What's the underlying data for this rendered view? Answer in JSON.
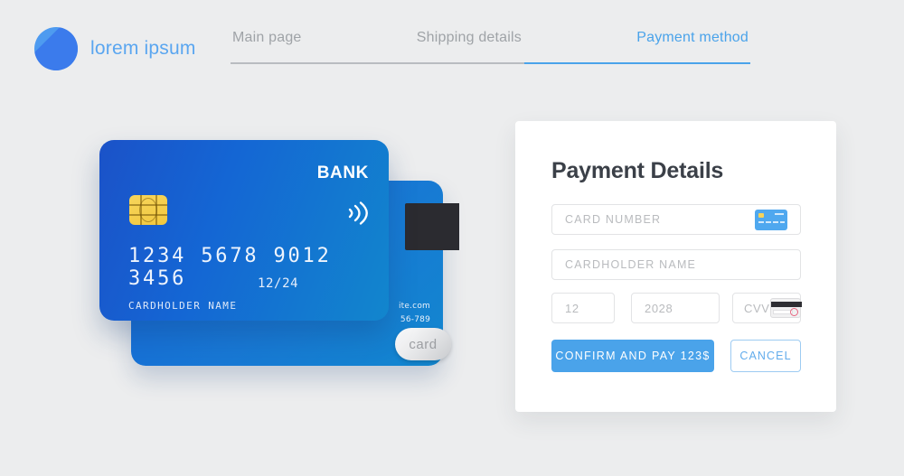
{
  "brand": {
    "name": "lorem ipsum",
    "logo_icon": "circle-triangle-logo-icon",
    "accent_color": "#5aa6f0"
  },
  "nav": {
    "tabs": [
      {
        "label": "Main page",
        "active": false
      },
      {
        "label": "Shipping details",
        "active": false
      },
      {
        "label": "Payment method",
        "active": true
      }
    ],
    "underline_active_color": "#4aa3ea",
    "underline_inactive_color": "#b9bcc0"
  },
  "card_front": {
    "bank_label": "BANK",
    "number": "1234 5678 9012 3456",
    "expiry": "12/24",
    "holder": "CARDHOLDER NAME",
    "chip_icon": "emv-chip-icon",
    "contactless_icon": "contactless-payment-icon",
    "gradient_from": "#1b52c8",
    "gradient_to": "#1286cd"
  },
  "card_back": {
    "magstripe_icon": "magnetic-stripe-icon",
    "line1": "ite.com",
    "line2": "56-789",
    "badge_label": "card",
    "gradient_from": "#1565d8",
    "gradient_to": "#1287cf"
  },
  "panel": {
    "title": "Payment Details",
    "fields": {
      "card_number": {
        "placeholder": "CARD NUMBER",
        "value": "",
        "icon": "credit-card-front-icon"
      },
      "cardholder_name": {
        "placeholder": "CARDHOLDER NAME",
        "value": ""
      },
      "expiry_month": {
        "placeholder": "12",
        "value": ""
      },
      "expiry_year": {
        "placeholder": "2028",
        "value": ""
      },
      "cvv": {
        "placeholder": "CVV",
        "value": "",
        "icon": "credit-card-back-cvv-icon"
      }
    },
    "buttons": {
      "confirm": "CONFIRM AND PAY 123$",
      "cancel": "CANCEL"
    },
    "primary_color": "#4aa3ea",
    "background": "#ffffff"
  },
  "page": {
    "background": "#ecedee"
  }
}
